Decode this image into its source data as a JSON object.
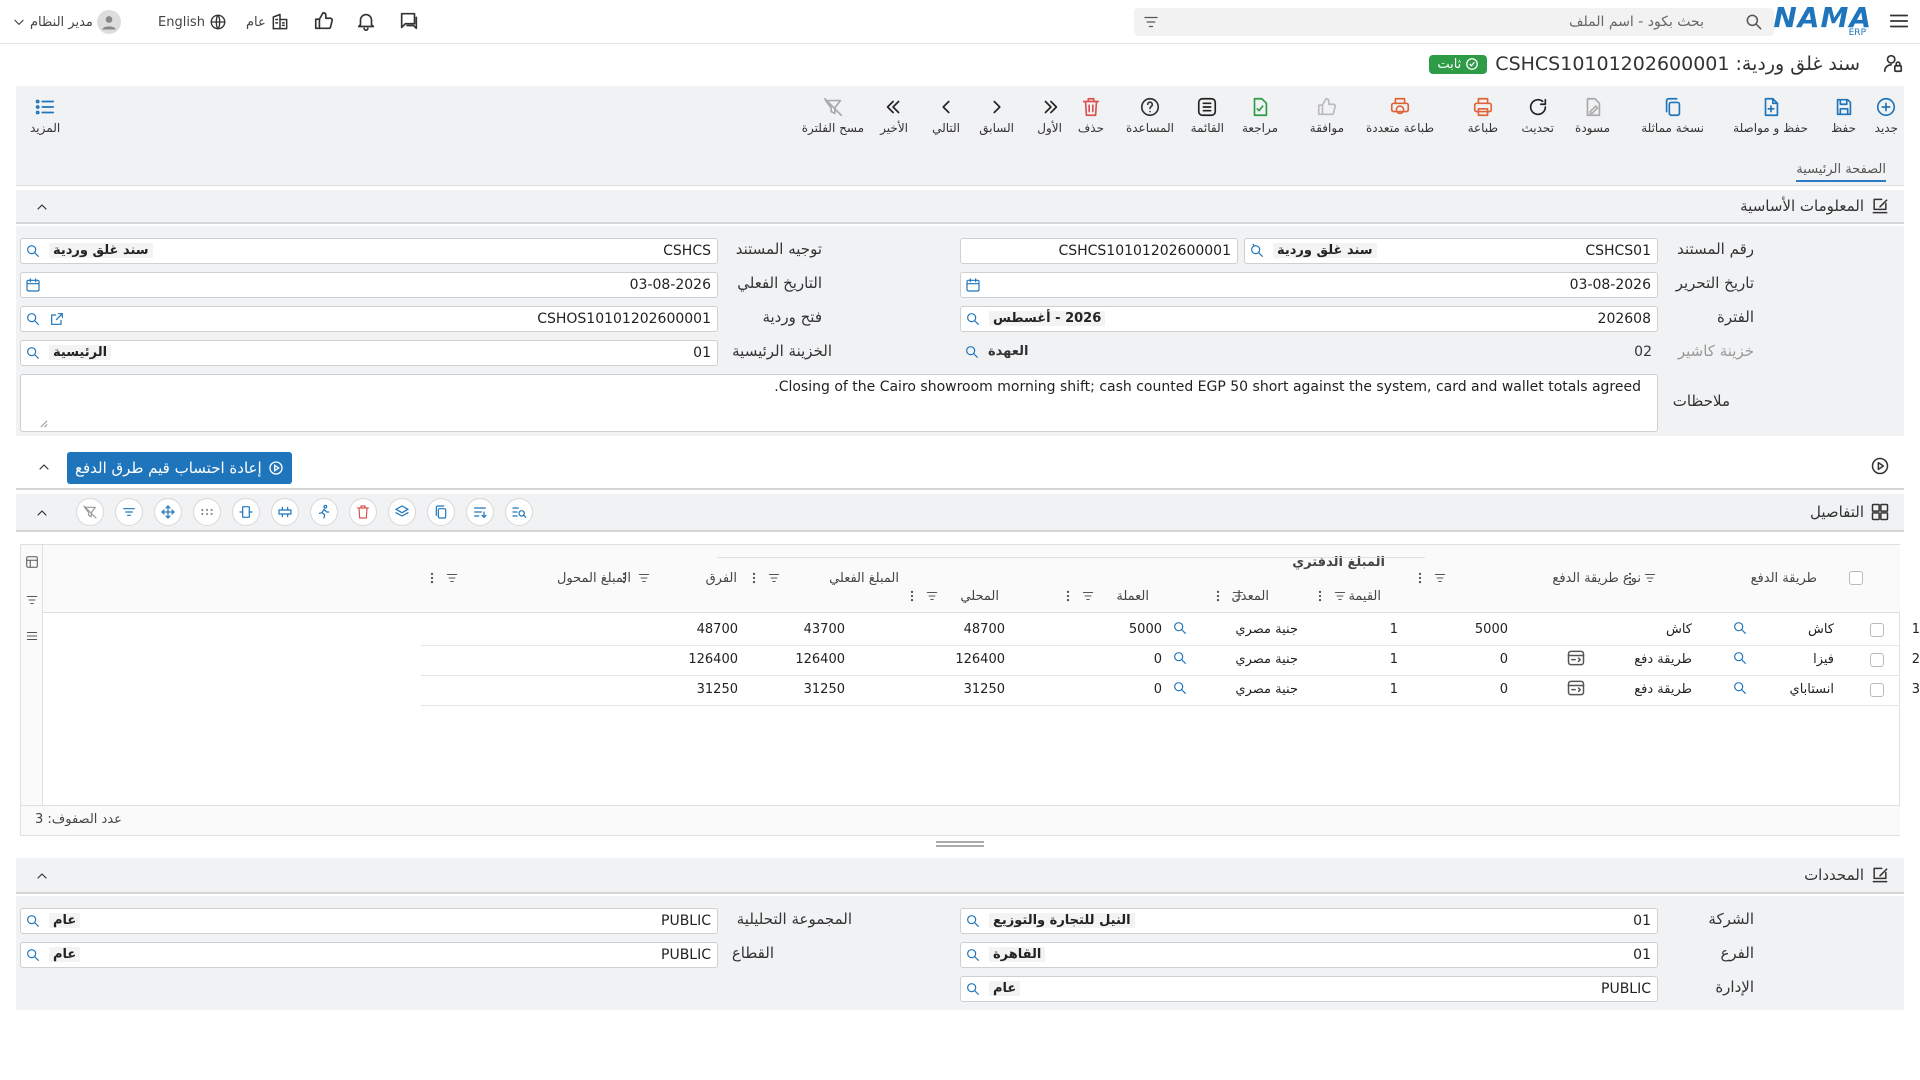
{
  "topbar": {
    "logo": "NAMA",
    "logo_sub": "ERP",
    "search_placeholder": "بحث بكود - اسم الملف",
    "user": "مدير النظام",
    "language": "English",
    "scope": "عام"
  },
  "title": {
    "text": "سند غلق وردية: CSHCS10101202600001",
    "status": "ثابت"
  },
  "toolbar": {
    "new": "جديد",
    "save": "حفظ",
    "save_continue": "حفظ و مواصلة",
    "duplicate": "نسخة مماثلة",
    "draft": "مسودة",
    "refresh": "تحديث",
    "print": "طباعة",
    "multi_print": "طباعة متعددة",
    "approve": "موافقة",
    "review": "مراجعة",
    "list": "القائمة",
    "help": "المساعدة",
    "delete": "حذف",
    "first": "الأول",
    "previous": "السابق",
    "next": "التالي",
    "last": "الأخير",
    "clear_filter": "مسح الفلترة",
    "more": "المزيد"
  },
  "tabs": {
    "main": "الصفحة الرئيسية"
  },
  "basic": {
    "section_title": "المعلومات الأساسية",
    "doc_number_label": "رقم المستند",
    "doc_number": "CSHCS01",
    "doc_number_name": "سند غلق وردية",
    "doc_code": "CSHCS10101202600001",
    "doc_direction_label": "توجيه المستند",
    "doc_direction": "CSHCS",
    "doc_direction_name": "سند غلق وردية",
    "issue_date_label": "تاريخ التحرير",
    "issue_date": "03-08-2026",
    "actual_date_label": "التاريخ الفعلي",
    "actual_date": "03-08-2026",
    "period_label": "الفترة",
    "period": "202608",
    "period_name": "2026 - أغسطس",
    "shift_open_label": "فتح وردية",
    "shift_open": "CSHOS10101202600001",
    "cashier_label": "خزينة كاشير",
    "cashier": "02",
    "cashier_name": "العهدة",
    "main_treasury_label": "الخزينة الرئيسية",
    "main_treasury": "01",
    "main_treasury_name": "الرئيسية",
    "notes_label": "ملاحظات",
    "notes": "Closing of the Cairo showroom morning shift; cash counted EGP 50 short against the system, card and wallet totals agreed."
  },
  "recalc_button": "إعادة احتساب قيم طرق الدفع",
  "details": {
    "section_title": "التفاصيل",
    "columns": {
      "payment_method": "طريقة الدفع",
      "payment_type": "نوع طريقة الدفع",
      "book_amount": "المبلغ الدفتري",
      "value": "القيمة",
      "rate": "المعدل",
      "currency": "العملة",
      "local": "المحلي",
      "actual": "المبلغ الفعلي",
      "difference": "الفرق",
      "transferred": "المبلغ المحول"
    },
    "rows": [
      {
        "n": "1",
        "method": "كاش",
        "type": "كاش",
        "value": "5000",
        "rate": "1",
        "currency": "جنية مصري",
        "local": "5000",
        "actual": "48700",
        "diff": "43700",
        "transferred": "48700"
      },
      {
        "n": "2",
        "method": "فيزا",
        "type": "طريقة دفع",
        "value": "0",
        "rate": "1",
        "currency": "جنية مصري",
        "local": "0",
        "actual": "126400",
        "diff": "126400",
        "transferred": "126400"
      },
      {
        "n": "3",
        "method": "انستاباي",
        "type": "طريقة دفع",
        "value": "0",
        "rate": "1",
        "currency": "جنية مصري",
        "local": "0",
        "actual": "31250",
        "diff": "31250",
        "transferred": "31250"
      }
    ],
    "row_count": "عدد الصفوف: 3"
  },
  "dims": {
    "section_title": "المحددات",
    "company_label": "الشركة",
    "company": "01",
    "company_name": "النيل للتجارة والتوزيع",
    "branch_label": "الفرع",
    "branch": "01",
    "branch_name": "القاهرة",
    "department_label": "الإدارة",
    "department": "PUBLIC",
    "department_name": "عام",
    "analytic_label": "المجموعة التحليلية",
    "analytic": "PUBLIC",
    "analytic_name": "عام",
    "sector_label": "القطاع",
    "sector": "PUBLIC",
    "sector_name": "عام"
  },
  "colors": {
    "accent": "#1f75bb",
    "status": "#2e9b47",
    "panel": "#f1f2f4",
    "delete": "#d9534f",
    "print": "#e0643a"
  }
}
